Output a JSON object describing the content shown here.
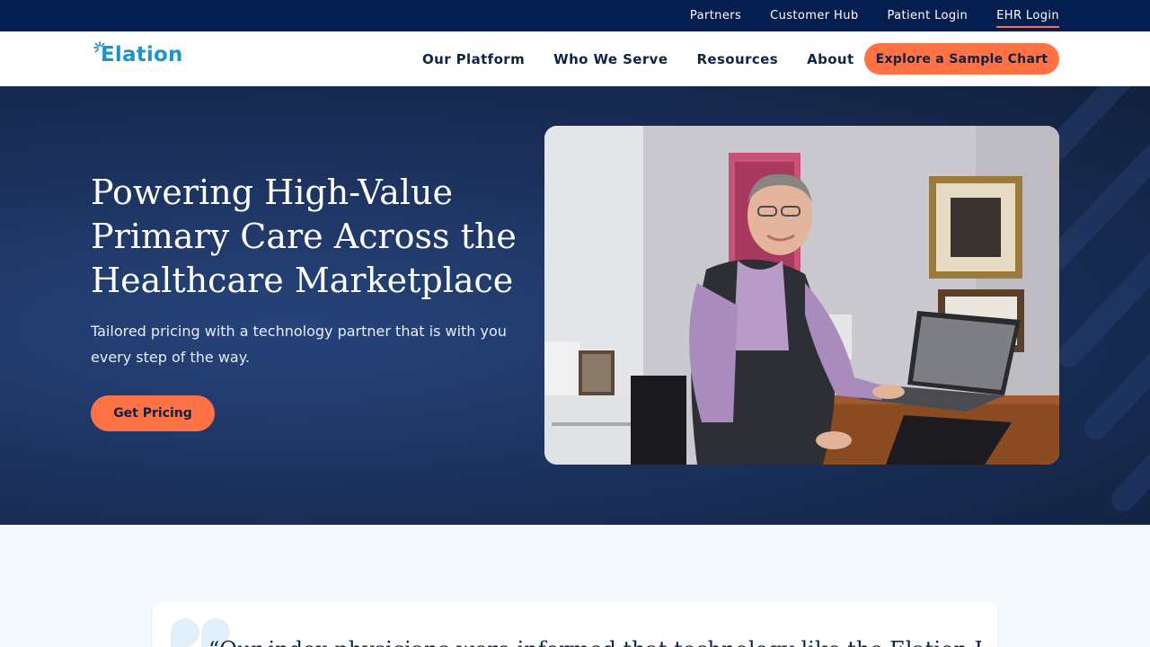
{
  "utility_bar": {
    "links": [
      {
        "label": "Partners"
      },
      {
        "label": "Customer Hub"
      },
      {
        "label": "Patient Login"
      },
      {
        "label": "EHR Login"
      }
    ]
  },
  "nav": {
    "logo_text": "Elation",
    "items": [
      {
        "label": "Our Platform"
      },
      {
        "label": "Who We Serve"
      },
      {
        "label": "Resources"
      },
      {
        "label": "About"
      }
    ],
    "cta_label": "Explore a Sample Chart"
  },
  "hero": {
    "title": "Powering High-Value Primary Care Across the Healthcare Marketplace",
    "subtitle": "Tailored pricing with a technology partner that is with you every step of the way.",
    "cta_label": "Get Pricing"
  },
  "testimonial": {
    "text": "“Our index physicians were informed that technology like the Elation EHR platform"
  },
  "colors": {
    "utility_bg": "#041e4f",
    "accent_orange": "#ff7246",
    "navy_text": "#0f2546",
    "brand_blue": "#1e95c8",
    "hero_bg": "#1f3766",
    "section_bg": "#f4f9fd"
  },
  "icons": {
    "logo_mark": "sunburst-icon",
    "quote": "quote-icon"
  }
}
